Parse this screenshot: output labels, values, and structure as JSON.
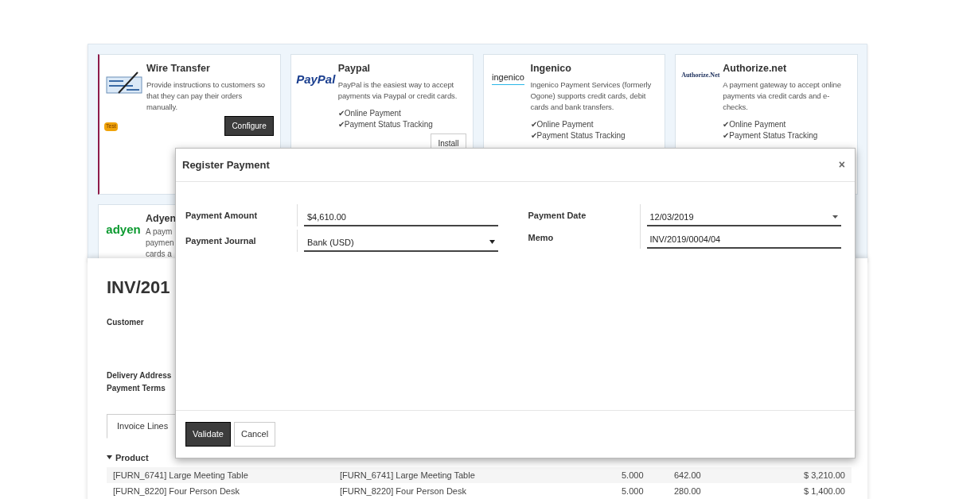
{
  "acquirers": [
    {
      "kind": "check",
      "name": "Wire Transfer",
      "description": "Provide instructions to customers so that they can pay their orders manually.",
      "badge": "Test",
      "installed": true,
      "button": "Configure"
    },
    {
      "kind": "paypal",
      "logo_text": "PayPal",
      "name": "Paypal",
      "description": "PayPal is the easiest way to accept payments via Paypal or credit cards.",
      "features": [
        {
          "mark": "✔",
          "label": "Online Payment"
        },
        {
          "mark": "✔",
          "label": "Payment Status Tracking"
        }
      ],
      "installed": false,
      "button": "Install"
    },
    {
      "kind": "ingenico",
      "logo_text": "ingenico",
      "name": "Ingenico",
      "description": "Ingenico Payment Services (formerly Ogone) supports credit cards, debit cards and bank transfers.",
      "features": [
        {
          "mark": "✔",
          "label": "Online Payment"
        },
        {
          "mark": "✔",
          "label": "Payment Status Tracking"
        }
      ],
      "installed": false
    },
    {
      "kind": "authorize",
      "logo_text": "Authorize.Net",
      "name": "Authorize.net",
      "description": "A payment gateway to accept online payments via credit cards and e-checks.",
      "features": [
        {
          "mark": "✔",
          "label": "Online Payment"
        },
        {
          "mark": "✔",
          "label": "Payment Status Tracking"
        }
      ],
      "installed": false
    },
    {
      "kind": "adyen",
      "logo_text": "adyen",
      "name": "Adyen",
      "description_lines": [
        "A paym",
        "paymen",
        "cards a"
      ],
      "installed": false
    }
  ],
  "invoice": {
    "title": "INV/201",
    "labels": [
      "Customer",
      "Delivery Address",
      "Payment Terms"
    ],
    "tab": {
      "label": "Invoice Lines",
      "selected": true
    },
    "column_1": "Product",
    "rows": [
      {
        "cells": [
          "[FURN_6741] Large Meeting Table",
          "[FURN_6741] Large Meeting Table",
          "5.000",
          "642.00",
          "$ 3,210.00"
        ]
      },
      {
        "cells": [
          "[FURN_8220] Four Person Desk",
          "[FURN_8220] Four Person Desk",
          "5.000",
          "280.00",
          "$ 1,400.00"
        ]
      }
    ]
  },
  "dialog": {
    "title": "Register Payment",
    "close": "×",
    "left_fields": [
      {
        "label": "Payment Amount",
        "value": "$4,610.00",
        "kind": "text"
      },
      {
        "label": "Payment Journal",
        "value": "Bank (USD)",
        "kind": "select"
      }
    ],
    "right_fields": [
      {
        "label": "Payment Date",
        "value": "12/03/2019",
        "kind": "date"
      },
      {
        "label": "Memo",
        "value": "INV/2019/0004/04",
        "kind": "text"
      }
    ],
    "buttons": [
      {
        "label": "Validate",
        "primary": true
      },
      {
        "label": "Cancel",
        "primary": false
      }
    ]
  }
}
